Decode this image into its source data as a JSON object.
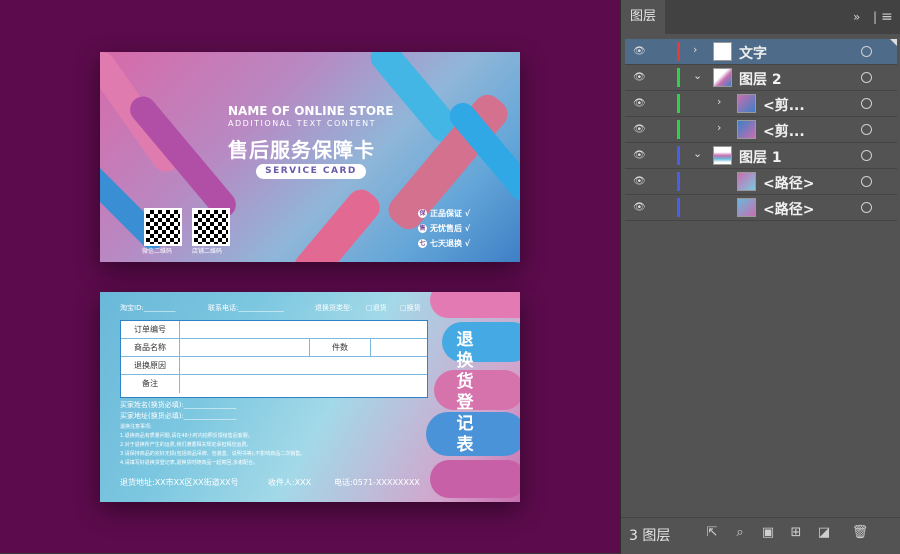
{
  "front_card": {
    "store_name": "NAME OF ONLINE STORE",
    "additional_text": "ADDITIONAL TEXT CONTENT",
    "title_cn": "售后服务保障卡",
    "service_card": "SERVICE CARD",
    "qr1_label": "微信二维码",
    "qr2_label": "店铺二维码",
    "features": [
      {
        "icon": "保",
        "text": "正品保证 √"
      },
      {
        "icon": "售",
        "text": "无忧售后 √"
      },
      {
        "icon": "七",
        "text": "七天退换 √"
      }
    ]
  },
  "back_card": {
    "taobao_id": "淘宝ID:_________",
    "phone": "联系电话:_____________",
    "return_type": "退换货类型:",
    "return_opt": "□退货",
    "exchange_opt": "□换货",
    "table": {
      "order_no": "订单编号",
      "product_name": "商品名称",
      "quantity": "件数",
      "reason": "退换原因",
      "remark": "备注"
    },
    "buyer_name": "买家姓名(换货必填):_______________",
    "buyer_addr": "买家地址(换货必填):_______________",
    "notes_title": "退换注意事项:",
    "notes": [
      "1.退换商品有质量问题,请在48小时内拍照反馈给售后客服。",
      "2.对于退换所产生的运费,我们遵循相关规定承担相应运费。",
      "3.请保持商品的完好无损(包括商品吊牌、包装盒、说明书等),不影响商品二次销售。",
      "4.请填写好退换货登记表,退换货时随商品一起寄回,多谢配合。"
    ],
    "address": "退货地址:XX市XX区XX街道XX号",
    "recipient": "收件人:XXX",
    "tel": "电话:0571-XXXXXXXX",
    "vertical_title": "退换货登记表"
  },
  "layers_panel": {
    "tab_label": "图层",
    "collapse_icon": "double-chevron-icon",
    "menu_icon": "hamburger-icon",
    "layers": [
      {
        "name": "文字",
        "color": "#e03c3c",
        "indent": 0,
        "expanded": false,
        "selected": true
      },
      {
        "name": "图层 2",
        "color": "#2fd14a",
        "indent": 0,
        "expanded": true,
        "selected": false
      },
      {
        "name": "<剪...",
        "color": "#2fd14a",
        "indent": 1,
        "expanded": false,
        "selected": false
      },
      {
        "name": "<剪...",
        "color": "#2fd14a",
        "indent": 1,
        "expanded": false,
        "selected": false
      },
      {
        "name": "图层 1",
        "color": "#4a5ee8",
        "indent": 0,
        "expanded": true,
        "selected": false
      },
      {
        "name": "<路径>",
        "color": "#4a5ee8",
        "indent": 2,
        "expanded": null,
        "selected": false
      },
      {
        "name": "<路径>",
        "color": "#4a5ee8",
        "indent": 2,
        "expanded": null,
        "selected": false
      }
    ],
    "footer_count": "3 图层"
  }
}
